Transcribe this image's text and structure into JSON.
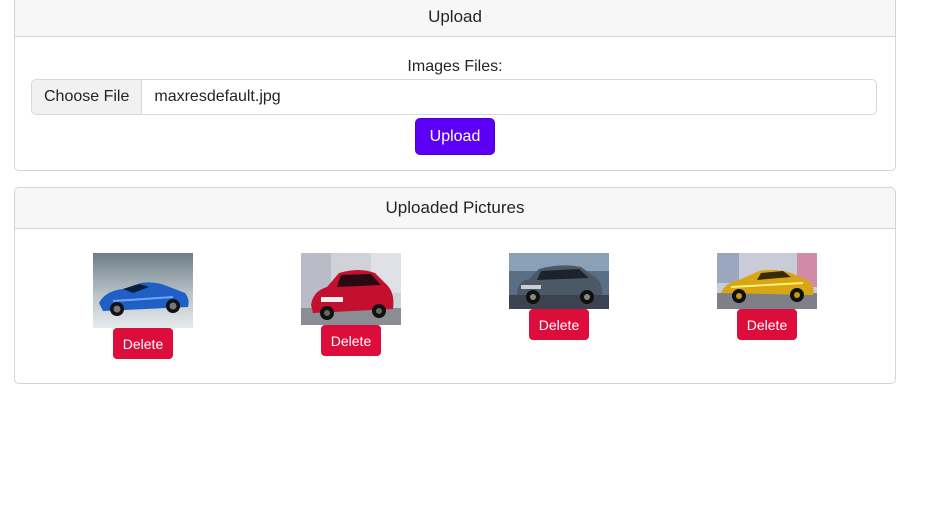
{
  "upload_card": {
    "title": "Upload",
    "field_label": "Images Files:",
    "choose_file_label": "Choose File",
    "selected_file": "maxresdefault.jpg",
    "upload_button": "Upload"
  },
  "pictures_card": {
    "title": "Uploaded Pictures",
    "pictures": [
      {
        "description": "blue sports convertible",
        "delete_label": "Delete"
      },
      {
        "description": "red hatchback",
        "delete_label": "Delete"
      },
      {
        "description": "grey SUV",
        "delete_label": "Delete"
      },
      {
        "description": "gold supercar",
        "delete_label": "Delete"
      }
    ]
  },
  "colors": {
    "primary_button": "#5b00f5",
    "delete_button": "#dc0c3b",
    "card_header_bg": "#f7f7f7"
  }
}
